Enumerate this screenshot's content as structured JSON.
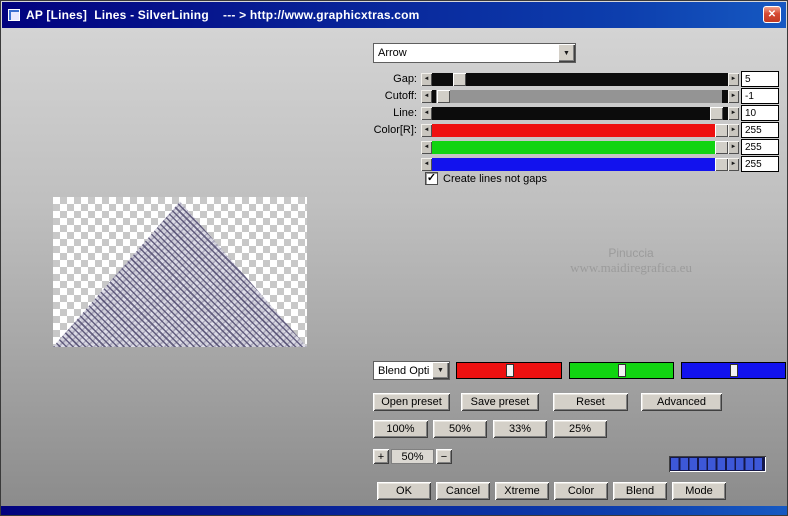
{
  "window": {
    "title": "AP [Lines]  Lines - SilverLining    --- > http://www.graphicxtras.com"
  },
  "icons": {
    "close": "✕",
    "dropdown": "▼",
    "check": "✓",
    "slider_left": "◄",
    "slider_right": "►"
  },
  "shape": {
    "selected": "Arrow"
  },
  "params": {
    "rows": [
      {
        "label": "Gap:",
        "value": "5"
      },
      {
        "label": "Cutoff:",
        "value": "-1"
      },
      {
        "label": "Line:",
        "value": "10"
      },
      {
        "label": "Color[R]:",
        "value": "255"
      },
      {
        "label": "",
        "value": "255"
      },
      {
        "label": "",
        "value": "255"
      }
    ],
    "checkbox_label": "Create lines not gaps",
    "checkbox_checked": true
  },
  "watermark": {
    "line1": "Pinuccia",
    "line2": "www.maidiregrafica.eu"
  },
  "blend": {
    "selected": "Blend Opti"
  },
  "presets": {
    "open": "Open preset",
    "save": "Save preset",
    "reset": "Reset",
    "advanced": "Advanced"
  },
  "zoom": {
    "p100": "100%",
    "p50": "50%",
    "p33": "33%",
    "p25": "25%",
    "plus": "+",
    "minus": "−",
    "current": "50%"
  },
  "actions": {
    "ok": "OK",
    "cancel": "Cancel",
    "xtreme": "Xtreme",
    "color": "Color",
    "blend": "Blend",
    "mode": "Mode"
  },
  "colors": {
    "red": "#ee1010",
    "green": "#11d411",
    "blue": "#1212ee",
    "titlebar": "#02027e",
    "accent_blue": "#3d58d8"
  }
}
